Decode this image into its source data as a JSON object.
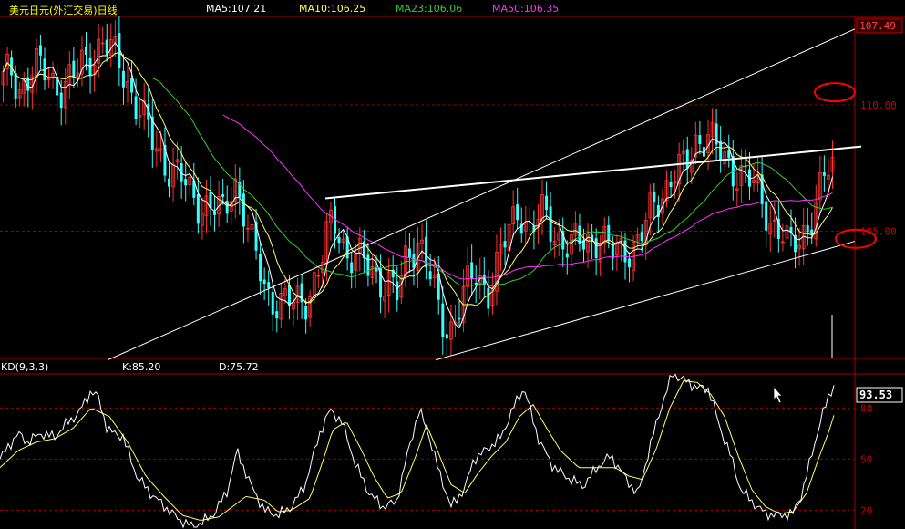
{
  "header": {
    "title": "美元日元(外汇交易)日线",
    "ma5": "MA5:107.21",
    "ma10": "MA10:106.25",
    "ma23": "MA23:106.06",
    "ma50": "MA50:106.35"
  },
  "kd_header": {
    "label": "KD(9,3,3)",
    "k": "K:85.20",
    "d": "D:75.72"
  },
  "colors": {
    "background": "#000000",
    "up": "#ff3333",
    "down": "#33ffff",
    "ma5": "#ffffff",
    "ma10": "#ffff66",
    "ma23": "#33cc33",
    "ma50": "#ff33ff",
    "grid": "#990000",
    "trendline": "#ffffff",
    "marker": "#ff0000",
    "title": "#ffff00"
  },
  "chart_data": [
    {
      "type": "candlestick",
      "y_axis": {
        "ticks": [
          "110.00",
          "105.00"
        ],
        "current_value": "107.49",
        "ylim": [
          100.0,
          113.5
        ]
      },
      "price_series": [
        {
          "name": "MA5",
          "key": "ma5",
          "last": 107.21
        },
        {
          "name": "MA10",
          "key": "ma10",
          "last": 106.25
        },
        {
          "name": "MA23",
          "key": "ma23",
          "last": 106.06
        },
        {
          "name": "MA50",
          "key": "ma50",
          "last": 106.35
        }
      ],
      "anchors_close": [
        [
          0,
          110.8
        ],
        [
          10,
          111.2
        ],
        [
          20,
          110.7
        ],
        [
          35,
          111.5
        ],
        [
          50,
          111.1
        ],
        [
          65,
          110.8
        ],
        [
          80,
          111.0
        ],
        [
          95,
          111.9
        ],
        [
          110,
          112.5
        ],
        [
          125,
          111.8
        ],
        [
          135,
          111.3
        ],
        [
          150,
          109.9
        ],
        [
          165,
          108.5
        ],
        [
          180,
          107.8
        ],
        [
          195,
          107.1
        ],
        [
          210,
          106.3
        ],
        [
          225,
          106.1
        ],
        [
          245,
          105.5
        ],
        [
          255,
          107.3
        ],
        [
          265,
          106.0
        ],
        [
          275,
          104.3
        ],
        [
          290,
          102.7
        ],
        [
          305,
          102.2
        ],
        [
          320,
          102.0
        ],
        [
          335,
          102.5
        ],
        [
          350,
          103.5
        ],
        [
          360,
          105.1
        ],
        [
          368,
          105.4
        ],
        [
          380,
          104.1
        ],
        [
          395,
          103.7
        ],
        [
          410,
          103.4
        ],
        [
          425,
          102.9
        ],
        [
          435,
          102.3
        ],
        [
          445,
          104.1
        ],
        [
          458,
          104.8
        ],
        [
          470,
          103.2
        ],
        [
          482,
          101.4
        ],
        [
          492,
          101.2
        ],
        [
          505,
          102.3
        ],
        [
          520,
          103.2
        ],
        [
          535,
          102.8
        ],
        [
          545,
          103.7
        ],
        [
          555,
          104.7
        ],
        [
          568,
          106.1
        ],
        [
          580,
          105.0
        ],
        [
          595,
          105.6
        ],
        [
          610,
          104.9
        ],
        [
          625,
          104.3
        ],
        [
          640,
          104.6
        ],
        [
          655,
          104.9
        ],
        [
          670,
          104.0
        ],
        [
          685,
          104.4
        ],
        [
          700,
          104.6
        ],
        [
          712,
          105.6
        ],
        [
          725,
          106.6
        ],
        [
          738,
          107.4
        ],
        [
          750,
          107.3
        ],
        [
          762,
          108.6
        ],
        [
          775,
          109.0
        ],
        [
          785,
          108.1
        ],
        [
          795,
          107.6
        ],
        [
          805,
          107.5
        ],
        [
          815,
          107.4
        ],
        [
          825,
          106.7
        ],
        [
          835,
          106.0
        ],
        [
          845,
          105.5
        ],
        [
          855,
          105.1
        ],
        [
          865,
          104.1
        ],
        [
          875,
          104.6
        ],
        [
          885,
          105.4
        ],
        [
          895,
          106.2
        ],
        [
          905,
          107.2
        ],
        [
          915,
          107.5
        ]
      ],
      "annotations": [
        {
          "type": "trendline",
          "from": [
            118,
            99.9
          ],
          "to": [
            938,
            113.0
          ]
        },
        {
          "type": "trendline",
          "from": [
            478,
            99.9
          ],
          "to": [
            938,
            104.6
          ]
        },
        {
          "type": "trendline",
          "from": [
            357,
            106.3
          ],
          "to": [
            945,
            108.35
          ]
        },
        {
          "type": "ellipse-marker",
          "at": [
            916,
            110.5
          ]
        },
        {
          "type": "ellipse-marker",
          "at": [
            939,
            104.7
          ]
        }
      ]
    },
    {
      "type": "line",
      "title": "KD(9,3,3)",
      "series": [
        {
          "name": "K",
          "key": "k",
          "last": 85.2
        },
        {
          "name": "D",
          "key": "d",
          "last": 75.72
        }
      ],
      "y_axis": {
        "ticks": [
          "80",
          "50",
          "20"
        ],
        "current_value": "93.53",
        "ylim": [
          10,
          100
        ]
      },
      "k_anchors": [
        [
          0,
          50
        ],
        [
          10,
          58
        ],
        [
          20,
          65
        ],
        [
          30,
          60
        ],
        [
          45,
          65
        ],
        [
          60,
          63
        ],
        [
          75,
          72
        ],
        [
          85,
          76
        ],
        [
          100,
          90
        ],
        [
          108,
          86
        ],
        [
          118,
          67
        ],
        [
          135,
          63
        ],
        [
          150,
          40
        ],
        [
          165,
          30
        ],
        [
          185,
          20
        ],
        [
          200,
          13
        ],
        [
          215,
          10
        ],
        [
          235,
          18
        ],
        [
          250,
          32
        ],
        [
          260,
          55
        ],
        [
          275,
          35
        ],
        [
          290,
          20
        ],
        [
          305,
          17
        ],
        [
          320,
          22
        ],
        [
          335,
          35
        ],
        [
          350,
          64
        ],
        [
          362,
          79
        ],
        [
          375,
          72
        ],
        [
          390,
          47
        ],
        [
          405,
          30
        ],
        [
          420,
          22
        ],
        [
          435,
          25
        ],
        [
          448,
          55
        ],
        [
          460,
          79
        ],
        [
          470,
          65
        ],
        [
          482,
          42
        ],
        [
          495,
          22
        ],
        [
          510,
          33
        ],
        [
          520,
          50
        ],
        [
          535,
          56
        ],
        [
          550,
          63
        ],
        [
          563,
          80
        ],
        [
          575,
          92
        ],
        [
          590,
          63
        ],
        [
          605,
          47
        ],
        [
          620,
          40
        ],
        [
          640,
          34
        ],
        [
          655,
          45
        ],
        [
          670,
          52
        ],
        [
          685,
          40
        ],
        [
          700,
          29
        ],
        [
          712,
          55
        ],
        [
          725,
          80
        ],
        [
          738,
          100
        ],
        [
          752,
          96
        ],
        [
          765,
          92
        ],
        [
          778,
          91
        ],
        [
          790,
          68
        ],
        [
          800,
          55
        ],
        [
          812,
          33
        ],
        [
          825,
          25
        ],
        [
          840,
          18
        ],
        [
          855,
          17
        ],
        [
          870,
          18
        ],
        [
          880,
          30
        ],
        [
          890,
          51
        ],
        [
          900,
          72
        ],
        [
          910,
          88
        ],
        [
          915,
          93.5
        ]
      ],
      "d_anchors": [
        [
          0,
          45
        ],
        [
          20,
          55
        ],
        [
          40,
          60
        ],
        [
          60,
          62
        ],
        [
          80,
          68
        ],
        [
          100,
          80
        ],
        [
          120,
          75
        ],
        [
          140,
          60
        ],
        [
          160,
          40
        ],
        [
          180,
          28
        ],
        [
          200,
          17
        ],
        [
          220,
          14
        ],
        [
          240,
          16
        ],
        [
          255,
          22
        ],
        [
          270,
          28
        ],
        [
          290,
          26
        ],
        [
          305,
          19
        ],
        [
          320,
          20
        ],
        [
          340,
          27
        ],
        [
          355,
          50
        ],
        [
          365,
          67
        ],
        [
          380,
          72
        ],
        [
          395,
          57
        ],
        [
          410,
          40
        ],
        [
          425,
          27
        ],
        [
          440,
          30
        ],
        [
          455,
          50
        ],
        [
          468,
          70
        ],
        [
          480,
          55
        ],
        [
          495,
          35
        ],
        [
          510,
          30
        ],
        [
          525,
          42
        ],
        [
          540,
          52
        ],
        [
          555,
          60
        ],
        [
          570,
          75
        ],
        [
          585,
          82
        ],
        [
          600,
          68
        ],
        [
          615,
          55
        ],
        [
          635,
          45
        ],
        [
          655,
          45
        ],
        [
          675,
          45
        ],
        [
          690,
          40
        ],
        [
          705,
          38
        ],
        [
          720,
          56
        ],
        [
          735,
          80
        ],
        [
          750,
          96
        ],
        [
          765,
          95
        ],
        [
          780,
          88
        ],
        [
          795,
          75
        ],
        [
          810,
          52
        ],
        [
          825,
          32
        ],
        [
          840,
          22
        ],
        [
          855,
          18
        ],
        [
          870,
          19
        ],
        [
          885,
          30
        ],
        [
          898,
          50
        ],
        [
          910,
          67
        ],
        [
          915,
          75.7
        ]
      ]
    }
  ]
}
